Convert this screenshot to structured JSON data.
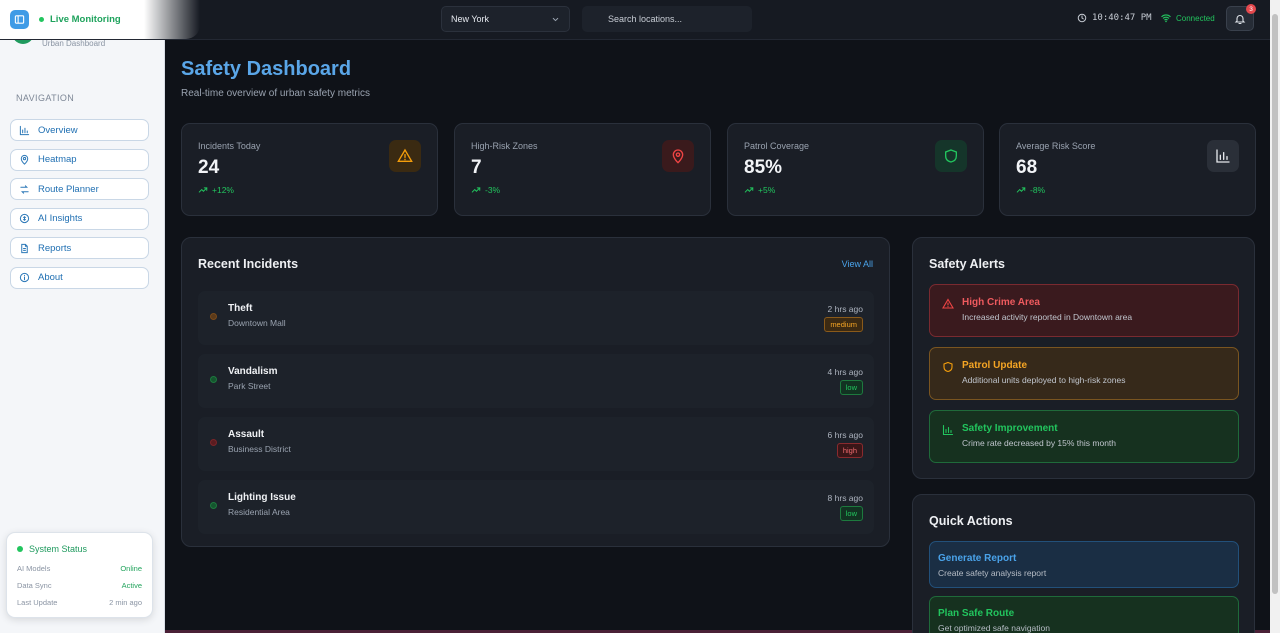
{
  "topbar": {
    "live_label": "Live Monitoring",
    "city": "New York",
    "search_placeholder": "Search locations...",
    "time": "10:40:47 PM",
    "connection": "Connected",
    "notification_count": "3"
  },
  "sidebar": {
    "brand_subtitle": "Urban Dashboard",
    "nav_heading": "NAVIGATION",
    "items": [
      {
        "label": "Overview",
        "icon": "bar-chart-icon"
      },
      {
        "label": "Heatmap",
        "icon": "map-pin-icon"
      },
      {
        "label": "Route Planner",
        "icon": "route-icon"
      },
      {
        "label": "AI Insights",
        "icon": "brain-icon"
      },
      {
        "label": "Reports",
        "icon": "file-icon"
      },
      {
        "label": "About",
        "icon": "info-icon"
      }
    ],
    "system_status": {
      "title": "System Status",
      "rows": [
        {
          "label": "AI Models",
          "value": "Online"
        },
        {
          "label": "Data Sync",
          "value": "Active"
        },
        {
          "label": "Last Update",
          "value": "2 min ago"
        }
      ]
    }
  },
  "header": {
    "title": "Safety Dashboard",
    "subtitle": "Real-time overview of urban safety metrics"
  },
  "stats": [
    {
      "label": "Incidents Today",
      "value": "24",
      "change": "+12%",
      "icon": "warning-icon",
      "color": "#f59e0b"
    },
    {
      "label": "High-Risk Zones",
      "value": "7",
      "change": "-3%",
      "icon": "map-pin-icon",
      "color": "#ef4444"
    },
    {
      "label": "Patrol Coverage",
      "value": "85%",
      "change": "+5%",
      "icon": "shield-icon",
      "color": "#22c55e"
    },
    {
      "label": "Average Risk Score",
      "value": "68",
      "change": "-8%",
      "icon": "bar-chart-icon",
      "color": "#e5e7eb"
    }
  ],
  "incidents_panel": {
    "title": "Recent Incidents",
    "view_all": "View All",
    "items": [
      {
        "title": "Theft",
        "location": "Downtown Mall",
        "time": "2 hrs ago",
        "severity": "medium"
      },
      {
        "title": "Vandalism",
        "location": "Park Street",
        "time": "4 hrs ago",
        "severity": "low"
      },
      {
        "title": "Assault",
        "location": "Business District",
        "time": "6 hrs ago",
        "severity": "high"
      },
      {
        "title": "Lighting Issue",
        "location": "Residential Area",
        "time": "8 hrs ago",
        "severity": "low"
      }
    ]
  },
  "alerts_panel": {
    "title": "Safety Alerts",
    "items": [
      {
        "title": "High Crime Area",
        "desc": "Increased activity reported in Downtown area",
        "icon": "warning-icon",
        "color": "#ef4444"
      },
      {
        "title": "Patrol Update",
        "desc": "Additional units deployed to high-risk zones",
        "icon": "shield-icon",
        "color": "#f59e0b"
      },
      {
        "title": "Safety Improvement",
        "desc": "Crime rate decreased by 15% this month",
        "icon": "bar-chart-icon",
        "color": "#22c55e"
      }
    ]
  },
  "actions_panel": {
    "title": "Quick Actions",
    "items": [
      {
        "title": "Generate Report",
        "desc": "Create safety analysis report",
        "color": "#4aa3ea"
      },
      {
        "title": "Plan Safe Route",
        "desc": "Get optimized safe navigation",
        "color": "#22c55e"
      }
    ]
  }
}
